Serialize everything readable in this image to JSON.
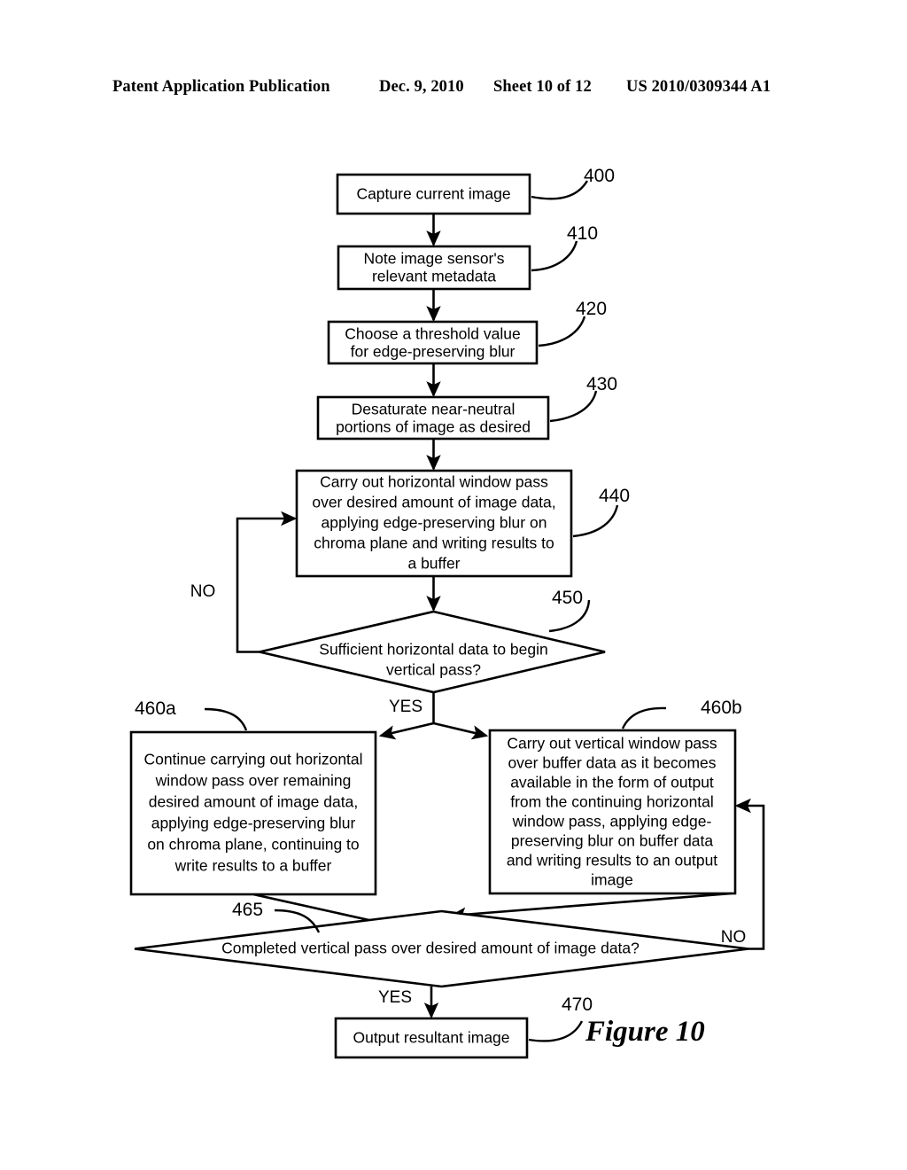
{
  "header": {
    "publication": "Patent Application Publication",
    "date": "Dec. 9, 2010",
    "sheet": "Sheet 10 of 12",
    "patent_number": "US 2010/0309344 A1"
  },
  "figure": {
    "caption": "Figure 10",
    "nodes": [
      {
        "id": "400",
        "ref": "400",
        "type": "process",
        "lines": [
          "Capture current image"
        ]
      },
      {
        "id": "410",
        "ref": "410",
        "type": "process",
        "lines": [
          "Note image sensor's",
          "relevant metadata"
        ]
      },
      {
        "id": "420",
        "ref": "420",
        "type": "process",
        "lines": [
          "Choose a threshold value",
          "for edge-preserving blur"
        ]
      },
      {
        "id": "430",
        "ref": "430",
        "type": "process",
        "lines": [
          "Desaturate near-neutral",
          "portions of image as desired"
        ]
      },
      {
        "id": "440",
        "ref": "440",
        "type": "process",
        "lines": [
          "Carry out horizontal window pass",
          "over desired amount of image data,",
          "applying edge-preserving blur on",
          "chroma plane and writing results to",
          "a buffer"
        ]
      },
      {
        "id": "450",
        "ref": "450",
        "type": "decision",
        "lines": [
          "Sufficient horizontal data to begin",
          "vertical pass?"
        ]
      },
      {
        "id": "460a",
        "ref": "460a",
        "type": "process",
        "lines": [
          "Continue carrying out horizontal",
          "window pass over remaining",
          "desired amount of image data,",
          "applying edge-preserving blur",
          "on chroma plane, continuing to",
          "write results to a buffer"
        ]
      },
      {
        "id": "460b",
        "ref": "460b",
        "type": "process",
        "lines": [
          "Carry out vertical window pass",
          "over buffer data as it becomes",
          "available in the form of output",
          "from the continuing horizontal",
          "window pass, applying edge-",
          "preserving blur on buffer data",
          "and writing results to an output",
          "image"
        ]
      },
      {
        "id": "465",
        "ref": "465",
        "type": "decision",
        "lines": [
          "Completed vertical pass over desired amount of image data?"
        ]
      },
      {
        "id": "470",
        "ref": "470",
        "type": "process",
        "lines": [
          "Output resultant image"
        ]
      }
    ],
    "branch_labels": {
      "no_450": "NO",
      "yes_450": "YES",
      "no_465": "NO",
      "yes_465": "YES"
    }
  }
}
